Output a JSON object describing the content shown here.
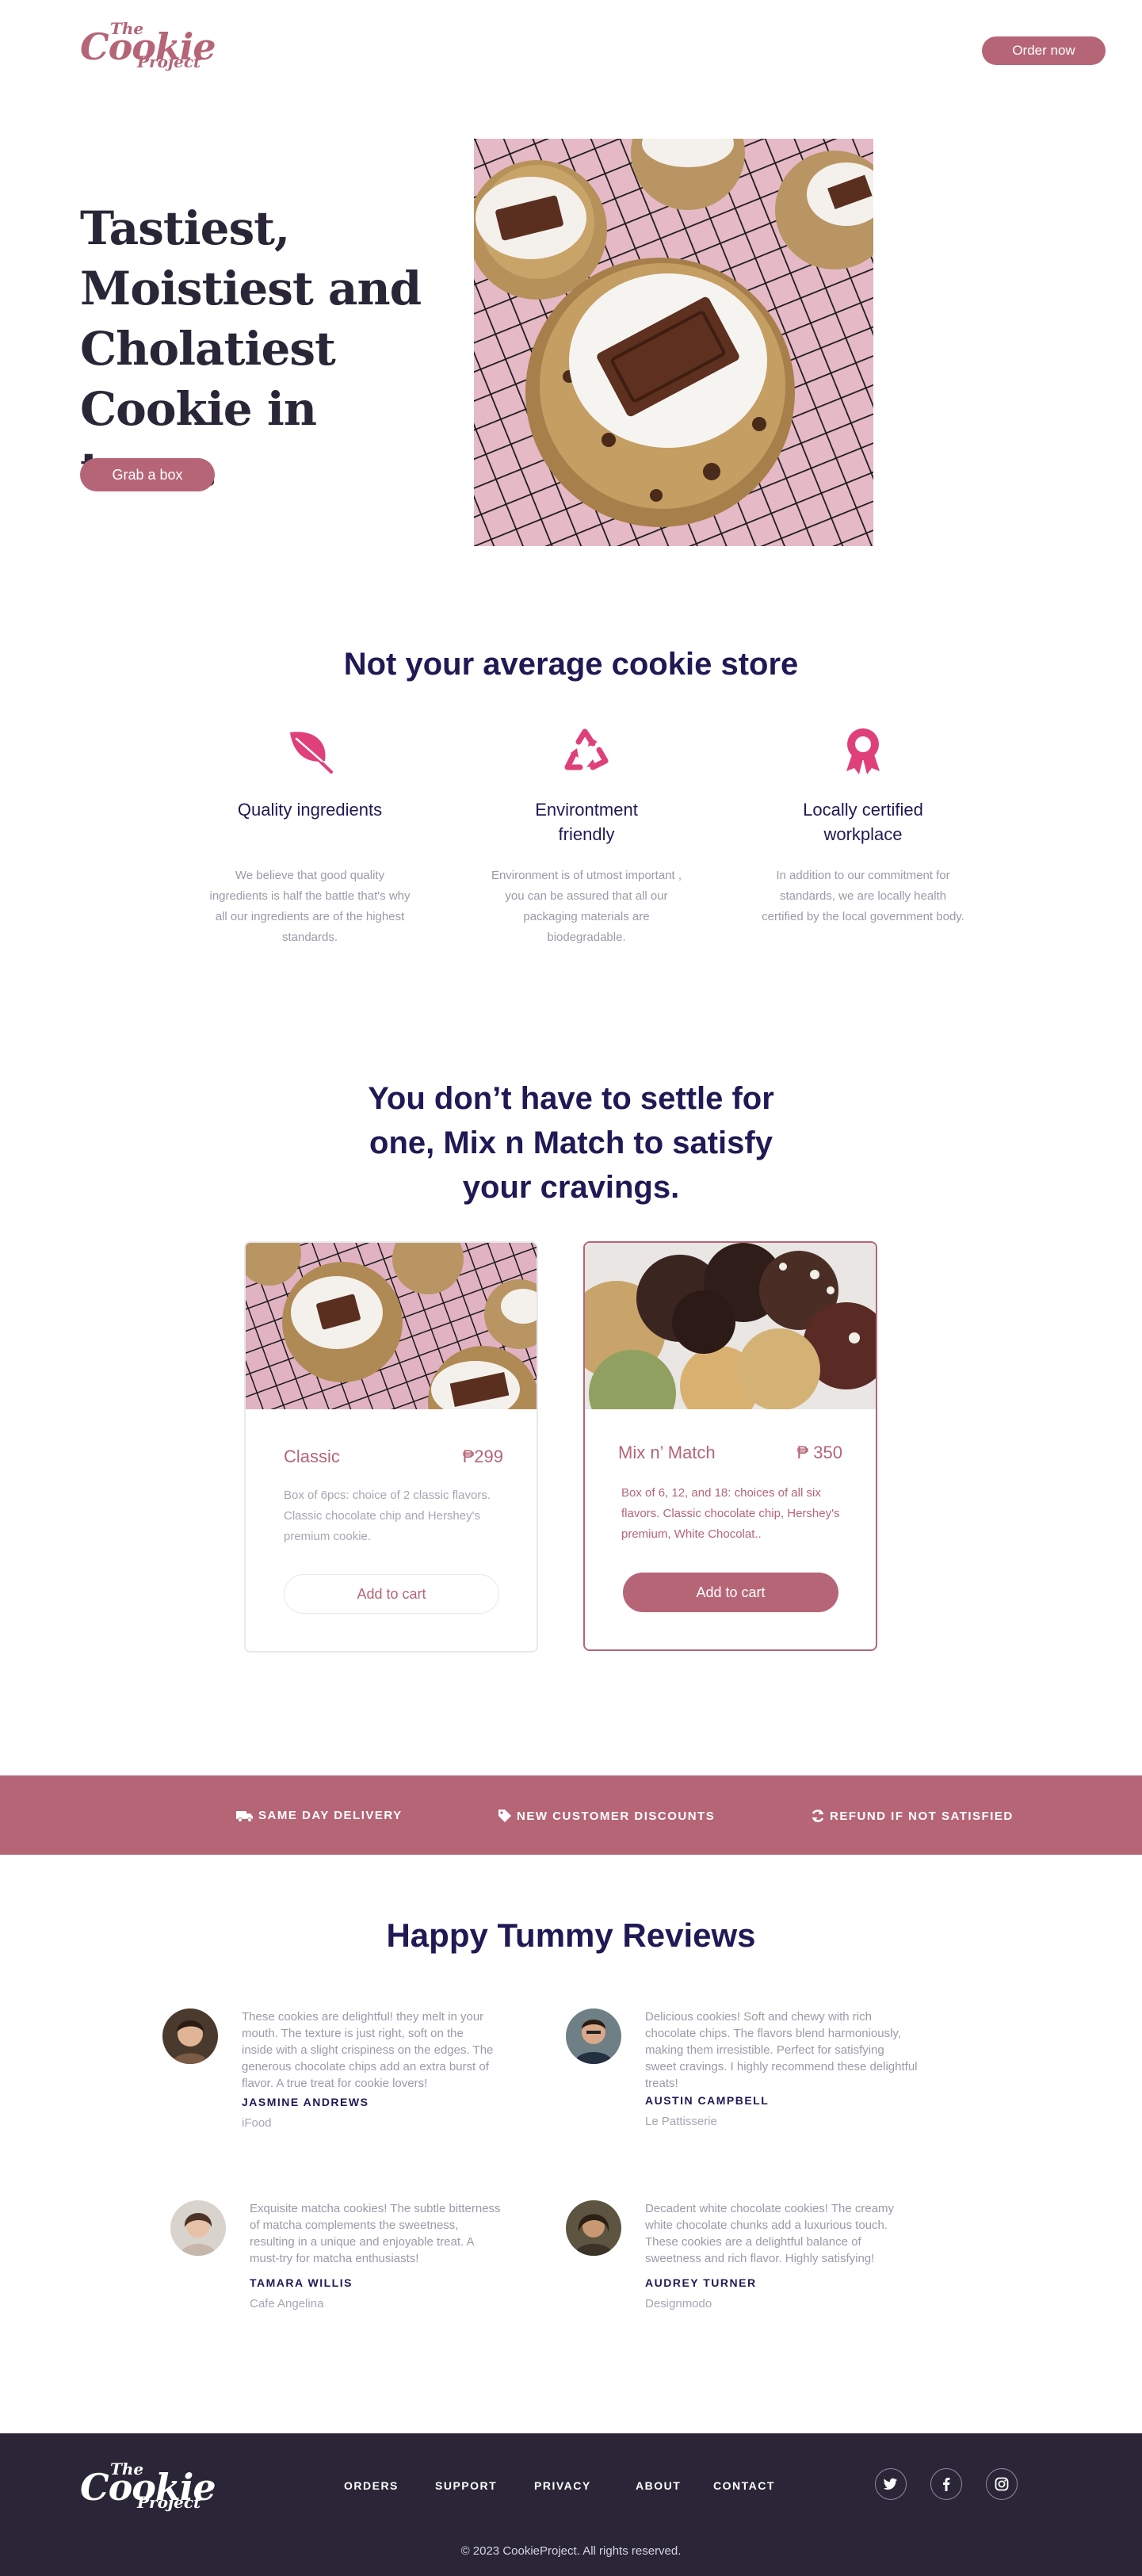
{
  "header": {
    "logo": {
      "line1": "The",
      "line2": "Cookie",
      "line3": "Project"
    },
    "order_button": "Order now"
  },
  "hero": {
    "title_lines": [
      "Tastiest,",
      "Moistiest and",
      "Cholatiest",
      "Cookie in town."
    ],
    "cta": "Grab a box"
  },
  "features": {
    "title": "Not your average cookie  store",
    "items": [
      {
        "name_lines": [
          "Quality ingredients",
          ""
        ],
        "icon": "leaf-icon",
        "description": "We believe that good quality ingredients is half the battle that's why all our ingredients are of the highest standards."
      },
      {
        "name_lines": [
          "Environtment",
          "friendly"
        ],
        "icon": "recycle-icon",
        "description": "Environment is of utmost important , you can be assured that all our packaging materials are biodegradable."
      },
      {
        "name_lines": [
          "Locally certified",
          "workplace"
        ],
        "icon": "award-icon",
        "description": "In addition to our commitment for standards, we are locally health certified by the local government body."
      }
    ]
  },
  "mix": {
    "title_lines": [
      "You don’t have to settle for",
      "one, Mix n Match to satisfy",
      "your cravings."
    ],
    "products": [
      {
        "name": "Classic",
        "price": "₱299",
        "description": "Box of 6pcs: choice of 2 classic flavors. Classic chocolate chip and Hershey's premium cookie.",
        "button": "Add to cart"
      },
      {
        "name": "Mix n’ Match",
        "price": "₱ 350",
        "description": "Box of 6, 12, and 18:  choices of all six flavors. Classic chocolate chip, Hershey's premium, White Chocolat..",
        "button": "Add to cart"
      }
    ]
  },
  "perks": [
    "SAME DAY DELIVERY",
    "NEW CUSTOMER DISCOUNTS",
    "REFUND IF NOT SATISFIED"
  ],
  "reviews": {
    "title": "Happy Tummy Reviews",
    "items": [
      {
        "text_lines": [
          "These cookies are delightful!  they melt in your",
          "mouth. The texture is just right, soft on the",
          "inside with a slight crispiness on the edges. The",
          "generous chocolate chips add an extra burst of",
          "flavor. A true treat for cookie lovers!"
        ],
        "name": "JASMINE ANDREWS",
        "place": "iFood"
      },
      {
        "text_lines": [
          "Delicious cookies! Soft and chewy with rich",
          "chocolate chips. The flavors blend harmoniously,",
          "making them irresistible. Perfect for satisfying",
          "sweet cravings. I highly recommend these delightful",
          "treats!"
        ],
        "name": "AUSTIN CAMPBELL",
        "place": "Le Pattisserie"
      },
      {
        "text_lines": [
          "Exquisite matcha cookies! The subtle bitterness",
          "of matcha complements the sweetness,",
          "resulting in a unique and enjoyable treat. A",
          "must-try for matcha enthusiasts!"
        ],
        "name": "TAMARA WILLIS",
        "place": "Cafe Angelina"
      },
      {
        "text_lines": [
          "Decadent white chocolate cookies! The creamy",
          "white chocolate chunks add a luxurious touch.",
          "These cookies are a delightful balance of",
          "sweetness and rich flavor. Highly satisfying!"
        ],
        "name": "AUDREY TURNER",
        "place": "Designmodo"
      }
    ]
  },
  "footer": {
    "logo": {
      "line1": "The",
      "line2": "Cookie",
      "line3": "Project"
    },
    "nav": [
      "ORDERS",
      "SUPPORT",
      "PRIVACY",
      "ABOUT",
      "CONTACT"
    ],
    "social": [
      "twitter-icon",
      "facebook-icon",
      "instagram-icon"
    ],
    "copyright": "© 2023 CookieProject. All rights reserved."
  },
  "colors": {
    "brand": "#b56576",
    "navy": "#1f1a55",
    "icon_pink": "#e0407a",
    "footer_bg": "#2a2637"
  }
}
